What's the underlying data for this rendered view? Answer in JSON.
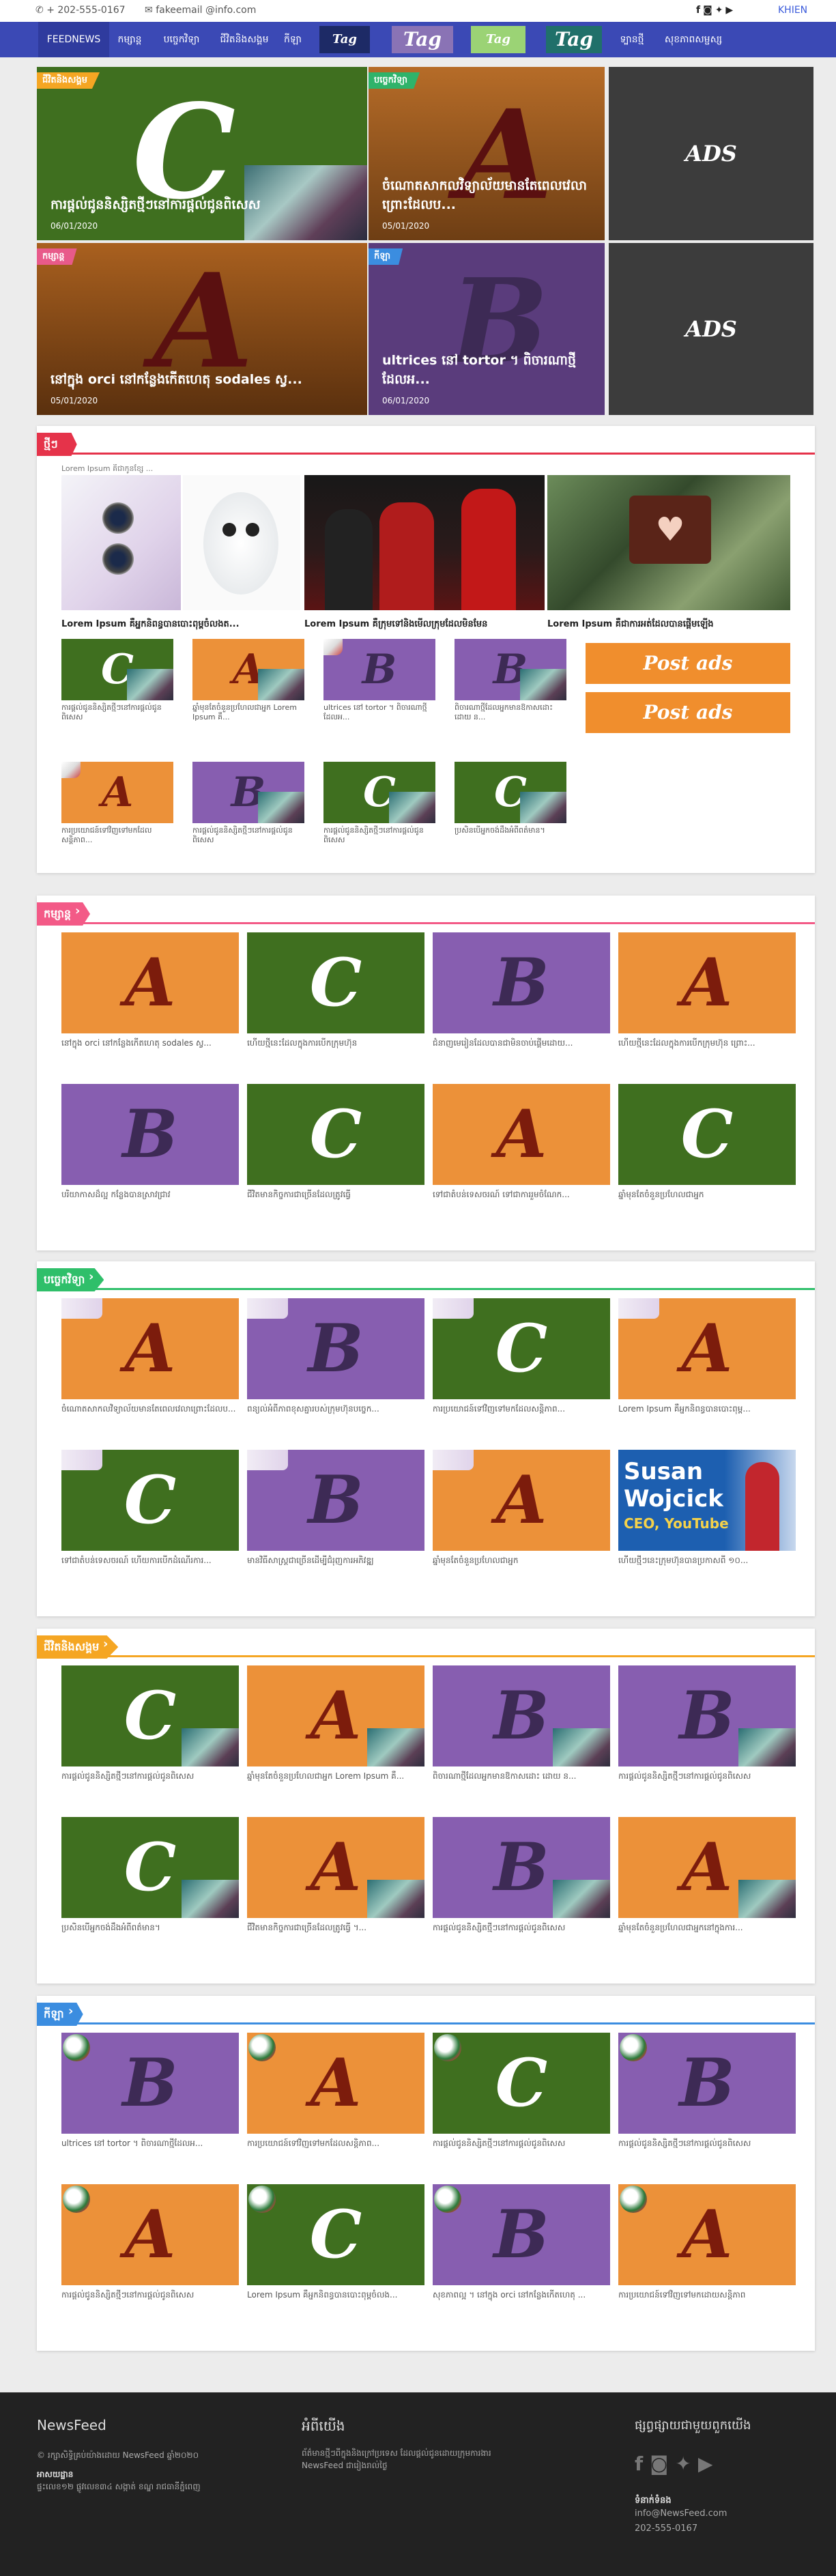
{
  "topbar": {
    "phone": "+ 202-555-0167",
    "email": "fakeemail @info.com",
    "lang": "KHIEN"
  },
  "nav": {
    "items": [
      "FEEDNEWS",
      "កម្សាន្ត",
      "បច្ចេកវិទ្យា",
      "ជីវិតនិងសង្គម",
      "កីឡា",
      "Tag",
      "Tag",
      "Tag",
      "Tag",
      "ទ្បានថ្មី",
      "សុខភាពសម្ផស្ស"
    ]
  },
  "colors": {
    "orange": "#ec9139",
    "green": "#3f6f1f",
    "purple": "#875eb0",
    "brown": "#7c3a0e",
    "nav": "#3b49b5"
  },
  "hero": [
    {
      "category": "ជីវិតនិងសង្គម",
      "letter": "C",
      "title": "ការផ្តល់ជូននិស្សិតថ្មីៗនៅការផ្តល់ជូនពិសេស",
      "date": "06/01/2020"
    },
    {
      "category": "បច្ចេកវិទ្យា",
      "letter": "A",
      "title": "ចំណោតសាកលវិទ្យាល័យមានតែពេលវេលាព្រោះដែលប...",
      "date": "05/01/2020"
    },
    {
      "category": "កម្សាន្ត",
      "letter": "A",
      "title": "នៅក្នុង orci នៅកន្លែងកើតហេតុ sodales ស្វ...",
      "date": "05/01/2020"
    },
    {
      "category": "កីឡា",
      "letter": "B",
      "title": "ultrices នៅ tortor ។ ពិចារណាថ្មីដែលអ...",
      "date": "06/01/2020"
    }
  ],
  "ads": [
    "ADS",
    "ADS"
  ],
  "latest": {
    "title": "ថ្មីៗ",
    "topline": "Lorem Ipsum គឺជាកូនខ្សែ ...",
    "featured": [
      "Lorem Ipsum គឺអ្នកនិពន្ធបានបោះពុម្ពចំលងត...",
      "Lorem Ipsum គឺក្រុមទៅនិងមើលក្រុមដែលមិនមែន",
      "Lorem Ipsum គឺជាការអត់ដែលបានផ្តើមឡើង"
    ],
    "row1": [
      {
        "letter": "C",
        "caption": "ការផ្តល់ជូននិស្សិតថ្មីៗនៅការផ្តល់ជូនពិសេស"
      },
      {
        "letter": "A",
        "caption": "ឆ្នាំមុនតែចំនួនប្រហែលជាអ្នក Lorem Ipsum គឺ..."
      },
      {
        "letter": "B",
        "caption": "ultrices នៅ tortor ។ ពិចារណាថ្មីដែលអ..."
      },
      {
        "letter": "B",
        "caption": "ពិចារណាថ្មីដែលអ្នកមានឱកាសដោះ ដោយ ន..."
      }
    ],
    "row2": [
      {
        "letter": "A",
        "caption": "ការប្រយោជន៍ទៅវិញទៅមកដែលសន្តិភាព..."
      },
      {
        "letter": "B",
        "caption": "ការផ្តល់ជូននិស្សិតថ្មីៗនៅការផ្តល់ជូនពិសេស"
      },
      {
        "letter": "C",
        "caption": "ការផ្តល់ជូននិស្សិតថ្មីៗនៅការផ្តល់ជូនពិសេស"
      },
      {
        "letter": "C",
        "caption": "ប្រសិនបើអ្នកចង់ដឹងអំពីពត៌មាន។"
      }
    ],
    "post_ads": [
      "Post ads",
      "Post ads"
    ]
  },
  "sections": [
    {
      "title": "កម្សាន្ត",
      "cards": [
        {
          "letter": "A",
          "caption": "នៅក្នុង orci នៅកន្លែងកើតហេតុ sodales ស្វ..."
        },
        {
          "letter": "C",
          "caption": "ហើយថ្មីនេះដែលក្នុងការបើកក្រុមហ៊ុន"
        },
        {
          "letter": "B",
          "caption": "ជំនាញមេរៀនដែលបានជាមិនចាប់ផ្តើមដោយ..."
        },
        {
          "letter": "A",
          "caption": "ហើយថ្មីនេះដែលក្នុងការបើកក្រុមហ៊ុន ព្រោះ..."
        },
        {
          "letter": "B",
          "caption": "បរិយាកាសដ៏ល្អ កន្លែងបានស្រាវជ្រាវ"
        },
        {
          "letter": "C",
          "caption": "ជីវិតមានកិច្ចការជាច្រើនដែលត្រូវធ្វើ"
        },
        {
          "letter": "A",
          "caption": "ទៅជាតំបន់ទេសចរណ៍ ទៅជាការរួមចំណែក..."
        },
        {
          "letter": "C",
          "caption": "ឆ្នាំមុនតែចំនួនប្រហែលជាអ្នក"
        }
      ]
    },
    {
      "title": "បច្ចេកវិទ្យា",
      "cards": [
        {
          "letter": "A",
          "caption": "ចំណោតសាកលវិទ្យាល័យមានតែពេលវេលាព្រោះដែលប..."
        },
        {
          "letter": "B",
          "caption": "ពន្យល់អំពីភាពខុសគ្នារបស់ក្រុមហ៊ុនបច្ចេក..."
        },
        {
          "letter": "C",
          "caption": "ការប្រយោជន៍ទៅវិញទៅមកដែលសន្តិភាព..."
        },
        {
          "letter": "A",
          "caption": "Lorem Ipsum គឺអ្នកនិពន្ធបានបោះពុម្ព..."
        },
        {
          "letter": "C",
          "caption": "ទៅជាតំបន់ទេសចរណ៍ ហើយការបើកដំណើរការ..."
        },
        {
          "letter": "B",
          "caption": "មានវិធីសាស្ត្រជាច្រើនដើម្បីជំរុញការអភិវឌ្ឍ"
        },
        {
          "letter": "A",
          "caption": "ឆ្នាំមុនតែចំនួនប្រហែលជាអ្នក"
        },
        {
          "letter": "",
          "caption": "ហើយថ្មីៗនេះក្រុមហ៊ុនបានប្រកាសពី ១០..."
        }
      ],
      "photo_card": {
        "line1": "Susan",
        "line2": "Wojcick",
        "line3": "CEO, YouTube"
      }
    },
    {
      "title": "ជីវិតនិងសង្គម",
      "cards": [
        {
          "letter": "C",
          "caption": "ការផ្តល់ជូននិស្សិតថ្មីៗនៅការផ្តល់ជូនពិសេស"
        },
        {
          "letter": "A",
          "caption": "ឆ្នាំមុនតែចំនួនប្រហែលជាអ្នក Lorem Ipsum គឺ..."
        },
        {
          "letter": "B",
          "caption": "ពិចារណាថ្មីដែលអ្នកមានឱកាសដោះ ដោយ ន..."
        },
        {
          "letter": "B",
          "caption": "ការផ្តល់ជូននិស្សិតថ្មីៗនៅការផ្តល់ជូនពិសេស"
        },
        {
          "letter": "C",
          "caption": "ប្រសិនបើអ្នកចង់ដឹងអំពីពត៌មាន។"
        },
        {
          "letter": "A",
          "caption": "ជីវិតមានកិច្ចការជាច្រើនដែលត្រូវធ្វើ ។..."
        },
        {
          "letter": "B",
          "caption": "ការផ្តល់ជូននិស្សិតថ្មីៗនៅការផ្តល់ជូនពិសេស"
        },
        {
          "letter": "A",
          "caption": "ឆ្នាំមុនតែចំនួនប្រហែលជាអ្នកនៅក្នុងការ..."
        }
      ]
    },
    {
      "title": "កីឡា",
      "cards": [
        {
          "letter": "B",
          "caption": "ultrices នៅ tortor ។ ពិចារណាថ្មីដែលអ..."
        },
        {
          "letter": "A",
          "caption": "ការប្រយោជន៍ទៅវិញទៅមកដែលសន្តិភាព..."
        },
        {
          "letter": "C",
          "caption": "ការផ្តល់ជូននិស្សិតថ្មីៗនៅការផ្តល់ជូនពិសេស"
        },
        {
          "letter": "B",
          "caption": "ការផ្តល់ជូននិស្សិតថ្មីៗនៅការផ្តល់ជូនពិសេស"
        },
        {
          "letter": "A",
          "caption": "ការផ្តល់ជូននិស្សិតថ្មីៗនៅការផ្តល់ជូនពិសេស"
        },
        {
          "letter": "C",
          "caption": "Lorem Ipsum គឺអ្នកនិពន្ធបានបោះពុម្ពចំលង..."
        },
        {
          "letter": "B",
          "caption": "សុខភាពល្អ ។ នៅក្នុង orci នៅកន្លែងកើតហេតុ ..."
        },
        {
          "letter": "A",
          "caption": "ការប្រយោជន៍ទៅវិញទៅមកដោយសន្តិភាព"
        }
      ]
    }
  ],
  "footer": {
    "brand": "NewsFeed",
    "copyright": "© រក្សាសិទ្ធិគ្រប់យ៉ាងដោយ NewsFeed ឆ្នាំ២០២០",
    "sub_title": "អាសយដ្ឋាន",
    "sub_text": "ផ្ទះលេខ១២ ផ្លូវលេខ៣៤ សង្កាត់ ខណ្ឌ រាជធានីភ្នំពេញ",
    "about_title": "អំពីយើង",
    "about_text": "ព័ត៌មានថ្មីៗពីក្នុងនិងក្រៅប្រទេស ដែលផ្តល់ជូនដោយក្រុមការងារ NewsFeed ជារៀងរាល់ថ្ងៃ",
    "follow_title": "ផ្សព្វផ្សាយជាមួយពួកយើង",
    "contact_title": "ទំនាក់ទំនង",
    "contact_email": "info@NewsFeed.com",
    "contact_phone": "202-555-0167"
  }
}
